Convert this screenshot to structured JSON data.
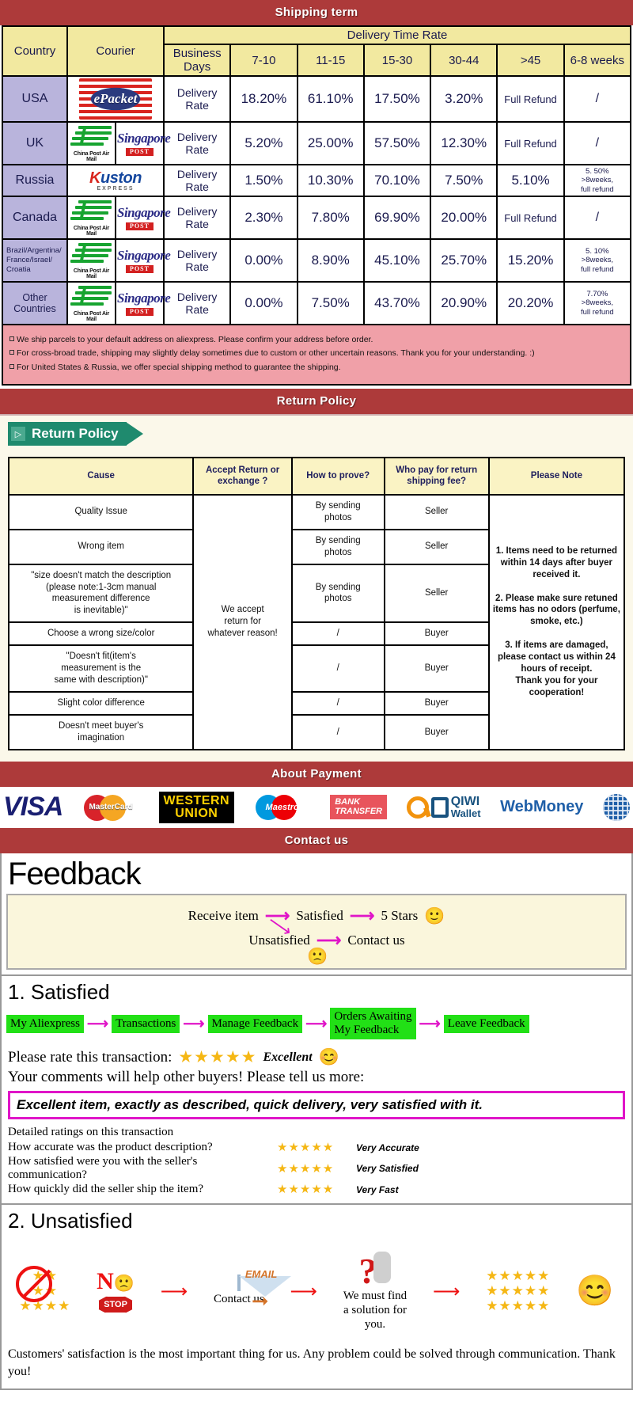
{
  "banners": {
    "shipping": "Shipping term",
    "return": "Return Policy",
    "payment": "About Payment",
    "contact": "Contact us"
  },
  "shipping_table": {
    "headers": {
      "country": "Country",
      "courier": "Courier",
      "delivery_time_rate": "Delivery Time Rate",
      "business_days": "Business Days",
      "cols": [
        "7-10",
        "11-15",
        "15-30",
        "30-44",
        ">45",
        "6-8 weeks"
      ]
    },
    "rows": [
      {
        "country": "USA",
        "country_style": "normal",
        "couriers": [
          "epacket"
        ],
        "rate_label": "Delivery Rate",
        "values": [
          "18.20%",
          "61.10%",
          "17.50%",
          "3.20%",
          "Full Refund",
          "/"
        ],
        "last_note": ""
      },
      {
        "country": "UK",
        "country_style": "normal",
        "couriers": [
          "china-post",
          "singapore-post"
        ],
        "rate_label": "Delivery Rate",
        "values": [
          "5.20%",
          "25.00%",
          "57.50%",
          "12.30%",
          "Full Refund",
          "/"
        ],
        "last_note": ""
      },
      {
        "country": "Russia",
        "country_style": "normal",
        "couriers": [
          "kuston"
        ],
        "rate_label": "Delivery Rate",
        "values": [
          "1.50%",
          "10.30%",
          "70.10%",
          "7.50%",
          "5.10%",
          "5. 50%\n>8weeks,\nfull refund"
        ],
        "last_note": "5. 50%\n>8weeks,\nfull refund"
      },
      {
        "country": "Canada",
        "country_style": "normal",
        "couriers": [
          "china-post",
          "singapore-post"
        ],
        "rate_label": "Delivery Rate",
        "values": [
          "2.30%",
          "7.80%",
          "69.90%",
          "20.00%",
          "Full Refund",
          "/"
        ],
        "last_note": ""
      },
      {
        "country": "Brazil/Argentina/\nFrance/Israel/\nCroatia",
        "country_style": "small",
        "couriers": [
          "china-post",
          "singapore-post"
        ],
        "rate_label": "Delivery Rate",
        "values": [
          "0.00%",
          "8.90%",
          "45.10%",
          "25.70%",
          "15.20%",
          "5. 10%\n>8weeks,\nfull refund"
        ],
        "last_note": "5. 10%\n>8weeks,\nfull refund"
      },
      {
        "country": "Other Countries",
        "country_style": "mid",
        "couriers": [
          "china-post",
          "singapore-post"
        ],
        "rate_label": "Delivery Rate",
        "values": [
          "0.00%",
          "7.50%",
          "43.70%",
          "20.90%",
          "20.20%",
          "7.70%\n>8weeks,\nfull refund"
        ],
        "last_note": "7.70%\n>8weeks,\nfull refund"
      }
    ],
    "notes": [
      "We ship parcels to your default address on aliexpress. Please confirm your address before order.",
      "For cross-broad trade, shipping may slightly delay sometimes due to custom or other uncertain reasons. Thank you for your understanding. :)",
      "For United States & Russia, we offer special shipping method to guarantee the shipping."
    ]
  },
  "courier_logos": {
    "epacket": "ePacket",
    "china_post": "China Post Air Mail",
    "singapore_post_word": "Singapore",
    "singapore_post_badge": "POST",
    "kuston_k": "K",
    "kuston_rest": "uston",
    "kuston_sub": "EXPRESS"
  },
  "return_policy": {
    "tag_label": "Return Policy",
    "tag_icon": "chevron-right-icon",
    "headers": [
      "Cause",
      "Accept Return\nor exchange ?",
      "How to prove?",
      "Who pay for return\nshipping fee?",
      "Please Note"
    ],
    "accept_cell": "We accept\nreturn for\nwhatever reason!",
    "rows": [
      {
        "cause": "Quality Issue",
        "prove": "By sending\nphotos",
        "pay": "Seller"
      },
      {
        "cause": "Wrong item",
        "prove": "By sending\nphotos",
        "pay": "Seller"
      },
      {
        "cause": "\"size doesn't match the description\n(please note:1-3cm manual\nmeasurement difference\nis inevitable)\"",
        "prove": "By sending\nphotos",
        "pay": "Seller"
      },
      {
        "cause": "Choose a wrong size/color",
        "prove": "/",
        "pay": "Buyer"
      },
      {
        "cause": "\"Doesn't fit(item's\nmeasurement is the\nsame with description)\"",
        "prove": "/",
        "pay": "Buyer"
      },
      {
        "cause": "Slight color difference",
        "prove": "/",
        "pay": "Buyer"
      },
      {
        "cause": "Doesn't meet buyer's\nimagination",
        "prove": "/",
        "pay": "Buyer"
      }
    ],
    "note": "1. Items need to be returned within 14 days after buyer received it.\n\n2. Please make sure retuned items has no odors (perfume, smoke, etc.)\n\n3. If items are damaged, please contact us within 24 hours of receipt.\nThank you for your cooperation!"
  },
  "payment_methods": [
    {
      "name": "visa",
      "label": "VISA"
    },
    {
      "name": "mastercard",
      "label": "MasterCard"
    },
    {
      "name": "western-union",
      "label_top": "WESTERN",
      "label_bottom": "UNION"
    },
    {
      "name": "maestro",
      "label": "Maestro"
    },
    {
      "name": "bank-transfer",
      "label_top": "BANK",
      "label_bottom": "TRANSFER"
    },
    {
      "name": "qiwi-wallet",
      "label_top": "QIWI",
      "label_bottom": "Wallet"
    },
    {
      "name": "webmoney",
      "label": "WebMoney"
    }
  ],
  "feedback": {
    "title": "Feedback",
    "flow": {
      "receive": "Receive item",
      "satisfied": "Satisfied",
      "five_stars": "5 Stars",
      "unsatisfied": "Unsatisfied",
      "contact_us": "Contact us",
      "happy_emoji": "🙂",
      "sad_emoji": "🙁"
    },
    "satisfied": {
      "heading": "1. Satisfied",
      "chain": [
        "My Aliexpress",
        "Transactions",
        "Manage Feedback",
        "Orders Awaiting\nMy Feedback",
        "Leave Feedback"
      ],
      "rate_prompt": "Please rate this transaction:",
      "stars": "★★★★★",
      "excellent": "Excellent",
      "smile": "😊",
      "comments_prompt": "Your comments will help other buyers! Please tell us more:",
      "quote": "Excellent item, exactly as described, quick delivery, very satisfied with it.",
      "detailed_head": "Detailed ratings on this transaction",
      "detailed": [
        {
          "question": "How accurate was the product description?",
          "stars": "★★★★★",
          "label": "Very Accurate"
        },
        {
          "question": "How satisfied were you with the seller's communication?",
          "stars": "★★★★★",
          "label": "Very Satisfied"
        },
        {
          "question": "How quickly did the seller ship the item?",
          "stars": "★★★★★",
          "label": "Very Fast"
        }
      ]
    },
    "unsatisfied": {
      "heading": "2. Unsatisfied",
      "no_letter": "N",
      "stop_label": "STOP",
      "email_label": "EMAIL",
      "contact_caption": "Contact us",
      "solution_caption": "We must find\na solution for\nyou.",
      "good_stars": "★★★★★\n★★★★★\n★★★★★",
      "closing": "Customers' satisfaction is the most important thing for us. Any problem could be solved through communication. Thank you!"
    }
  },
  "colors": {
    "banner_red": "#ad3a3a",
    "table_header_yellow": "#f2e9a0",
    "country_purple": "#b9b4dc",
    "notice_pink": "#f0a0a8",
    "tag_green": "#1f8a6e",
    "chip_green": "#22e016",
    "magenta": "#e015c8",
    "star_gold": "#f5b714"
  }
}
